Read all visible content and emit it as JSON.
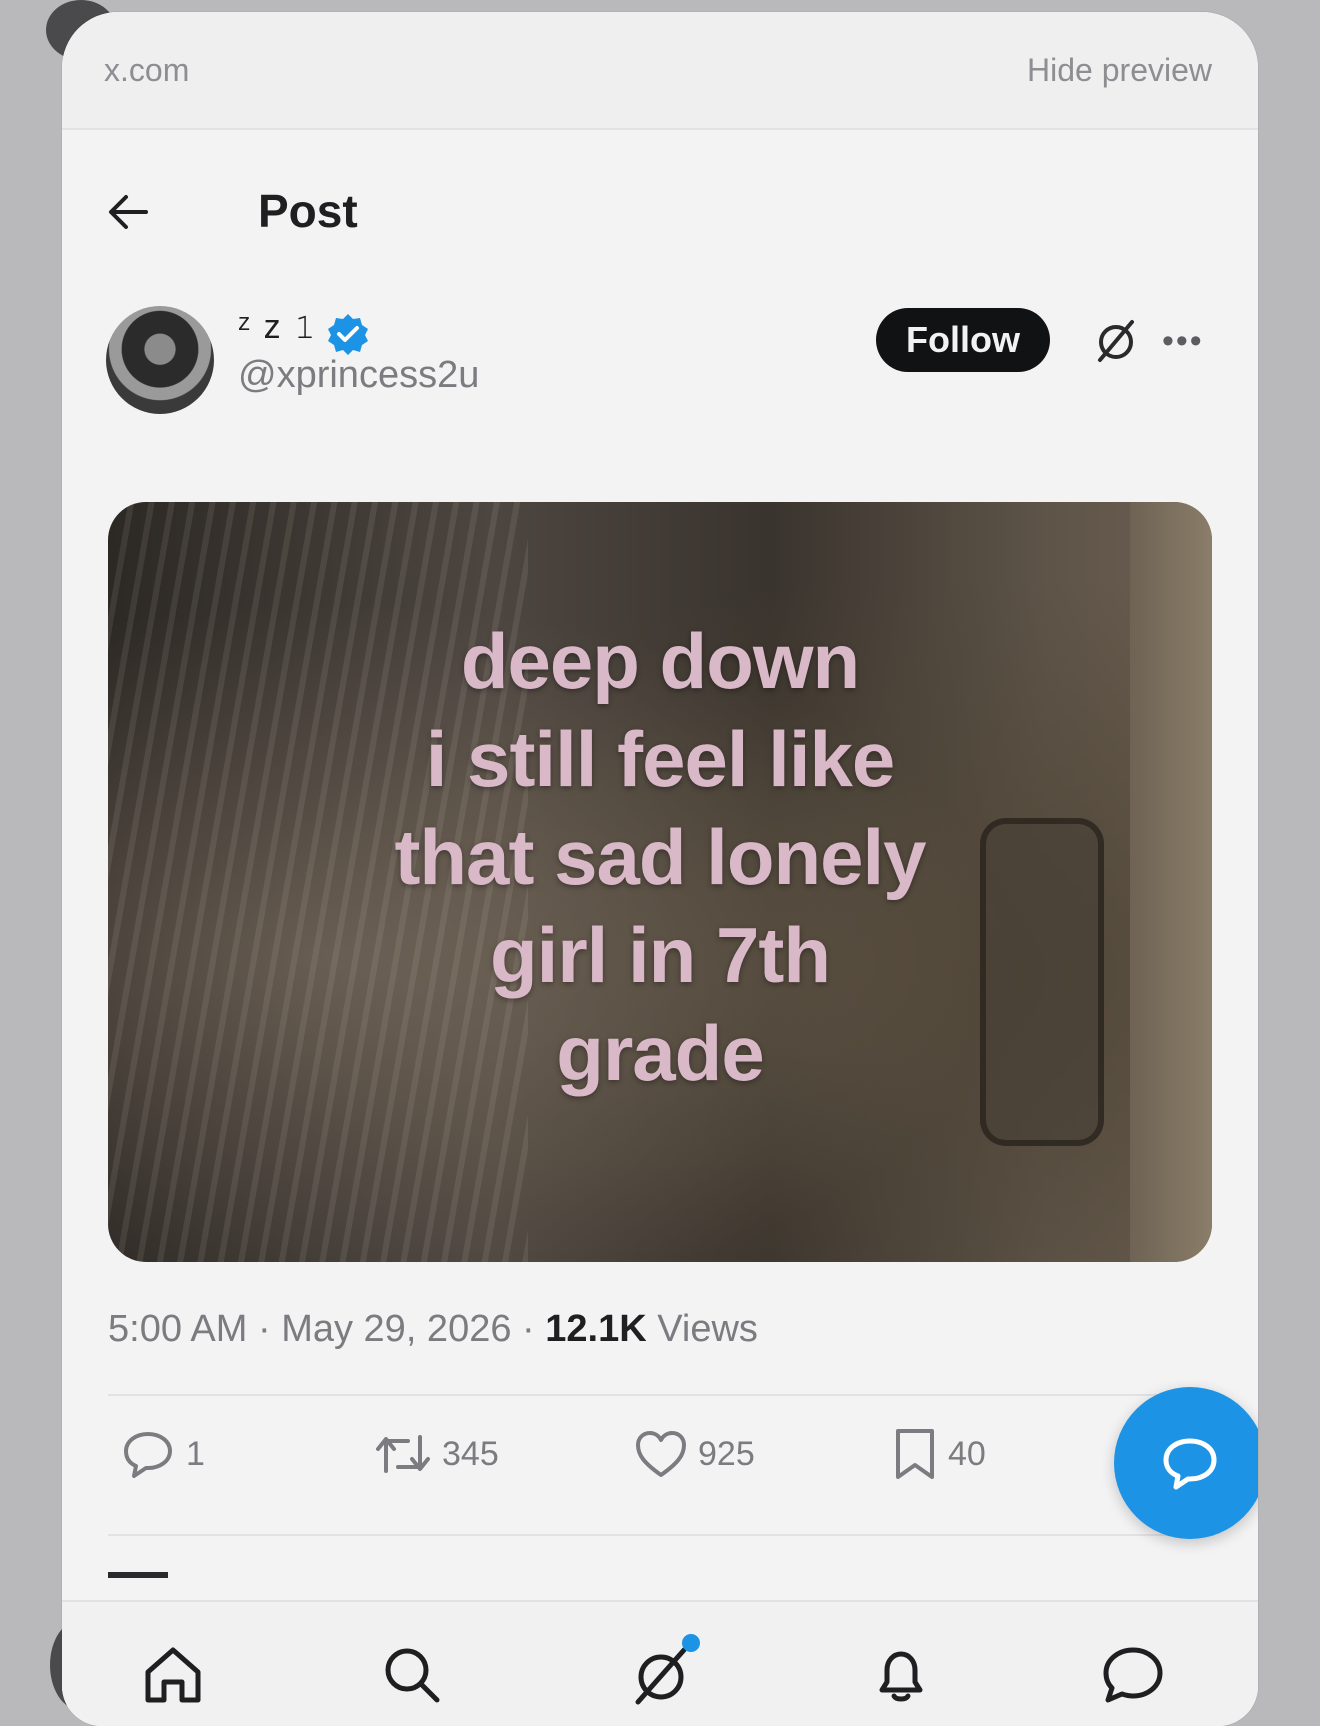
{
  "browser": {
    "host": "x.com",
    "hide_preview": "Hide preview"
  },
  "header": {
    "title": "Post"
  },
  "author": {
    "display_name": "ᶻ z 𝟷",
    "handle": "@xprincess2u",
    "follow_label": "Follow"
  },
  "media": {
    "caption_lines": [
      "deep down",
      "i still feel like",
      "that sad lonely",
      "girl in 7th",
      "grade"
    ]
  },
  "meta": {
    "time": "5:00 AM",
    "date": "May 29, 2026",
    "views_count": "12.1K",
    "views_label": "Views"
  },
  "actions": {
    "replies": "1",
    "reposts": "345",
    "likes": "925",
    "bookmarks": "40"
  },
  "colors": {
    "accent": "#1d93e6",
    "follow_bg": "#111214"
  }
}
